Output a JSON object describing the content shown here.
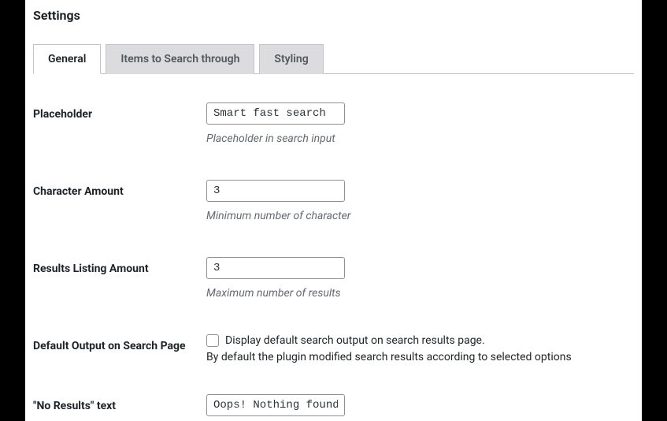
{
  "page_title": "Settings",
  "tabs": {
    "general": "General",
    "items": "Items to Search through",
    "styling": "Styling"
  },
  "fields": {
    "placeholder": {
      "label": "Placeholder",
      "value": "Smart fast search",
      "desc": "Placeholder in search input"
    },
    "char_amount": {
      "label": "Character Amount",
      "value": "3",
      "desc": "Minimum number of character"
    },
    "results_amount": {
      "label": "Results Listing Amount",
      "value": "3",
      "desc": "Maximum number of results"
    },
    "default_output": {
      "label": "Default Output on Search Page",
      "checkbox_label": "Display default search output on search results page.",
      "desc": "By default the plugin modified search results according to selected options"
    },
    "no_results": {
      "label": "\"No Results\" text",
      "value": "Oops! Nothing found"
    }
  }
}
